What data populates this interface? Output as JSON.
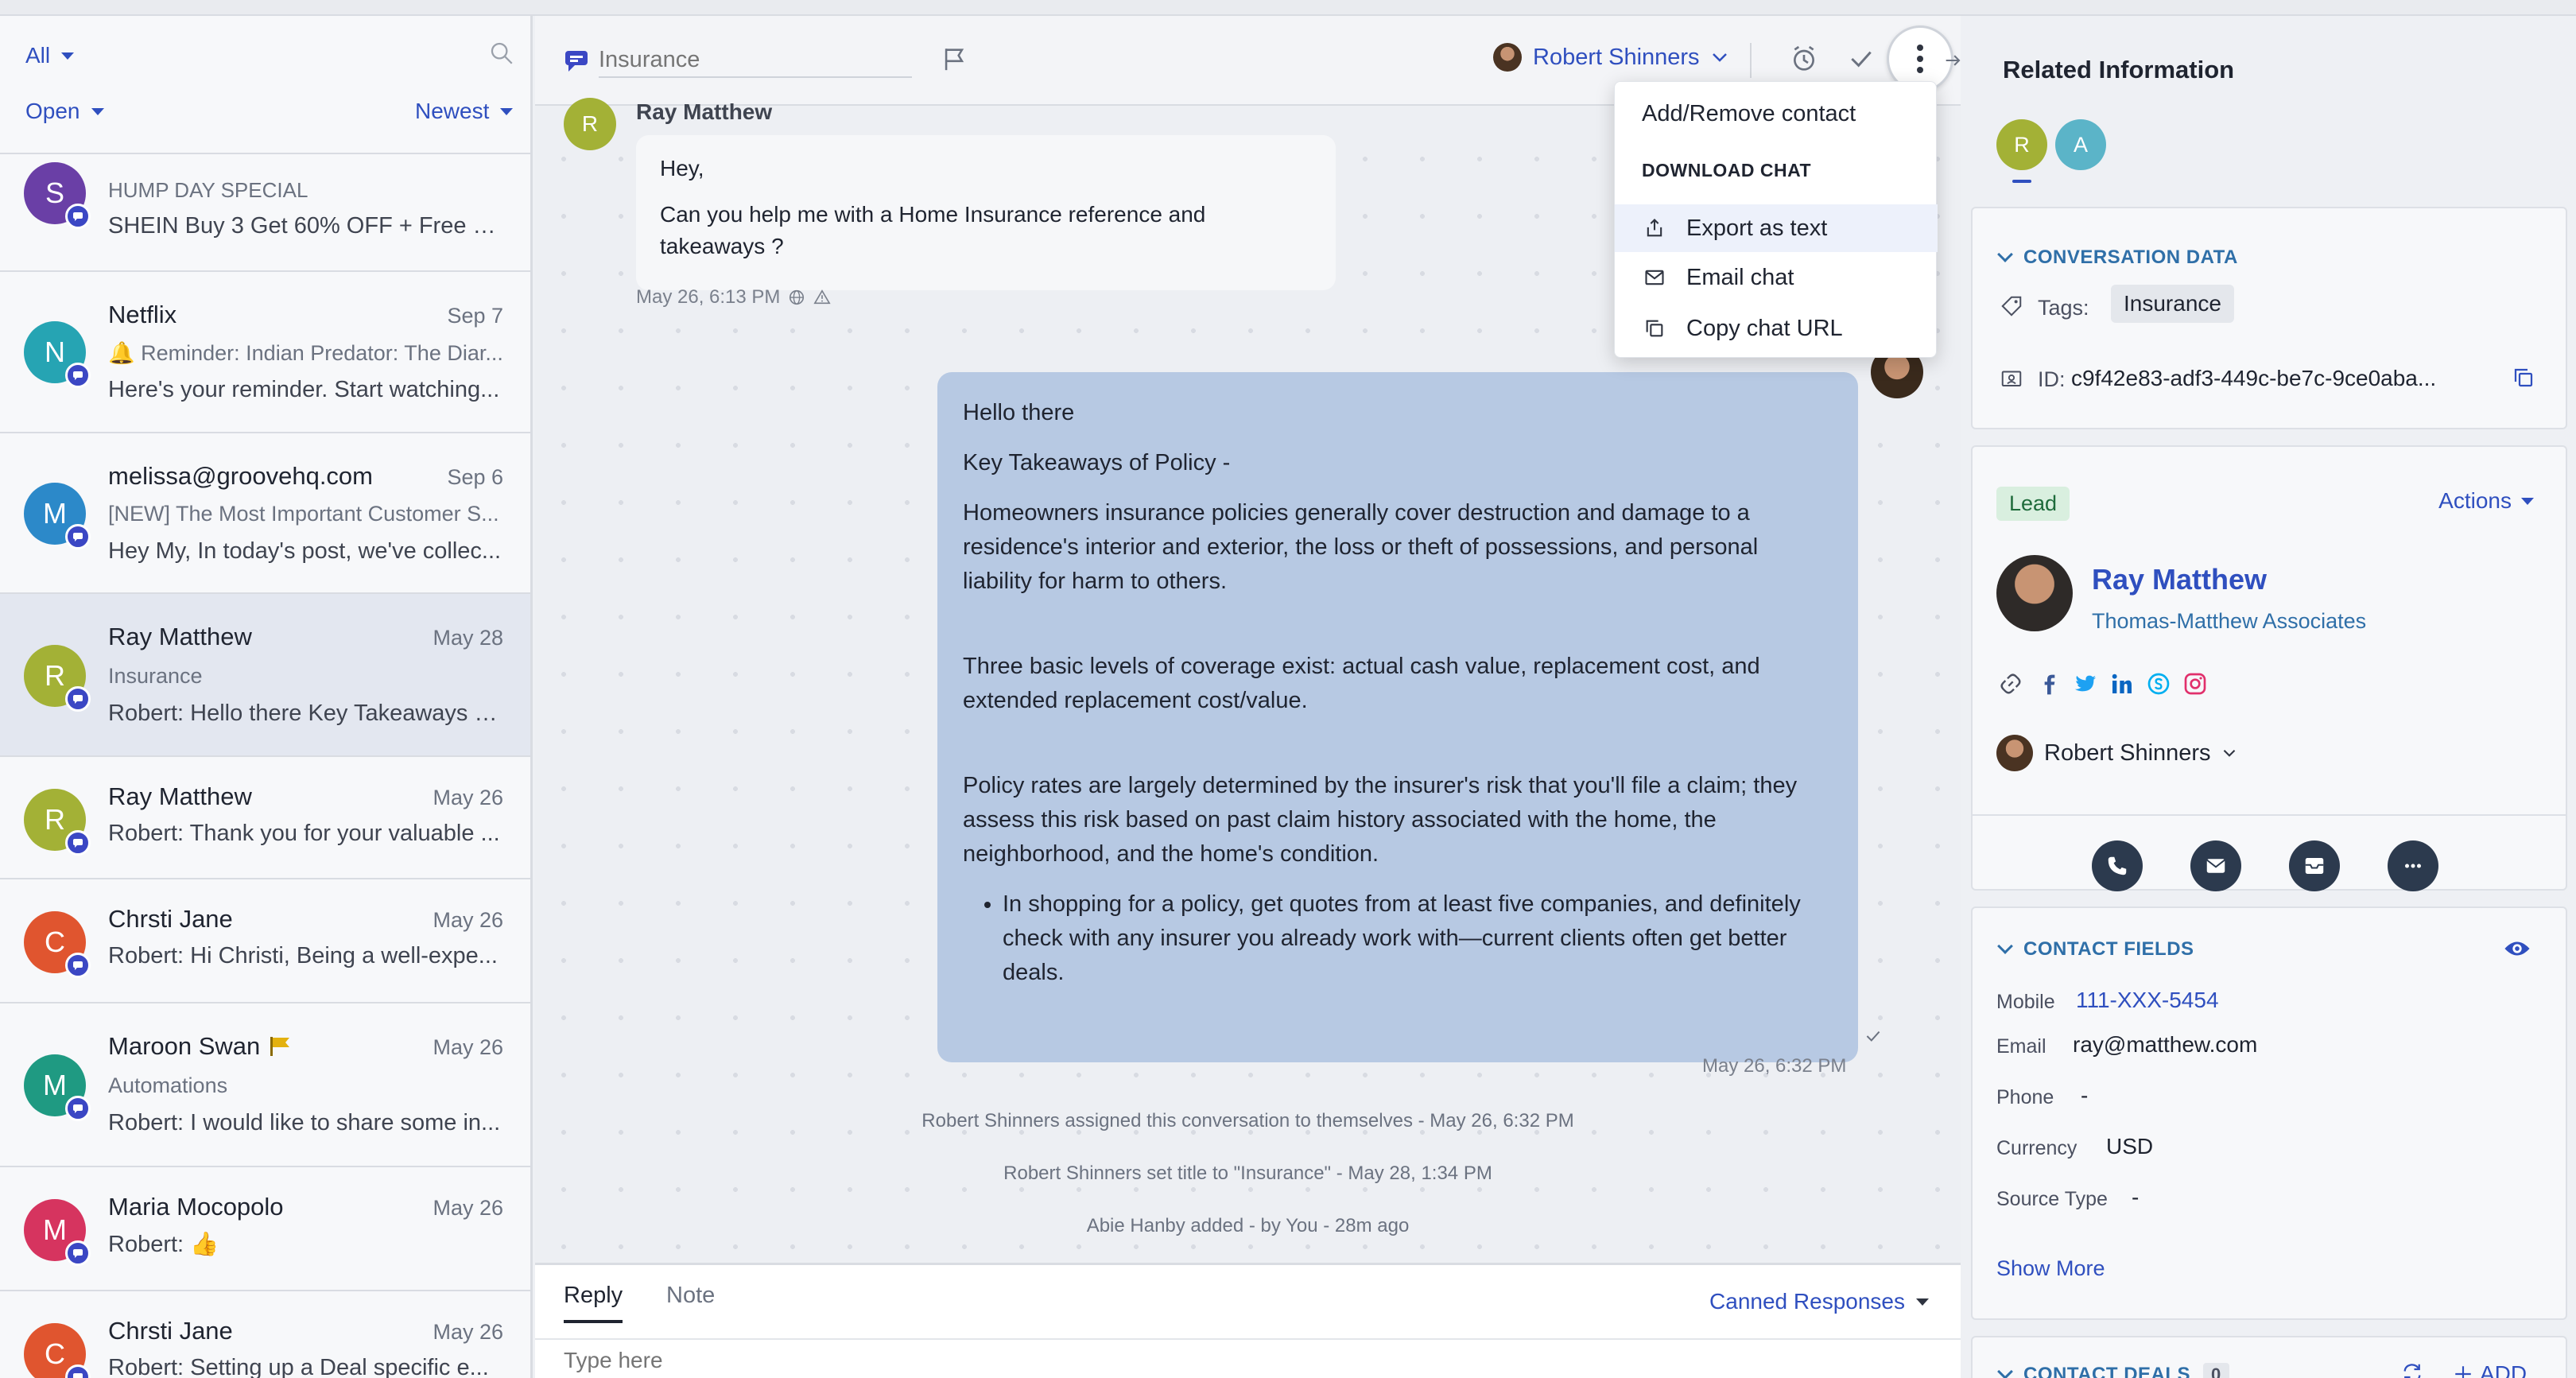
{
  "list": {
    "filter_all": "All",
    "filter_status": "Open",
    "filter_sort": "Newest",
    "conversations": [
      {
        "initial": "S",
        "avatar_color": "#6a3fa6",
        "name": "",
        "date": "",
        "line1": "HUMP DAY SPECIAL",
        "line2": "SHEIN Buy 3 Get 60% OFF + Free S..."
      },
      {
        "initial": "N",
        "avatar_color": "#26a4b3",
        "name": "Netflix",
        "date": "Sep 7",
        "line1": "🔔 Reminder: Indian Predator: The Diar...",
        "line2": "Here's your reminder. Start watching..."
      },
      {
        "initial": "M",
        "avatar_color": "#2c89c9",
        "name": "melissa@groovehq.com",
        "date": "Sep 6",
        "line1": "[NEW] The Most Important Customer S...",
        "line2": "Hey My, In today's post, we've collec..."
      },
      {
        "initial": "R",
        "avatar_color": "#a3b136",
        "name": "Ray Matthew",
        "date": "May 28",
        "line1": "Insurance",
        "line2": "Robert: Hello there Key Takeaways o..."
      },
      {
        "initial": "R",
        "avatar_color": "#a3b136",
        "name": "Ray Matthew",
        "date": "May 26",
        "line1": "",
        "line2": "Robert: Thank you for your valuable ..."
      },
      {
        "initial": "C",
        "avatar_color": "#e0552f",
        "name": "Chrsti Jane",
        "date": "May 26",
        "line1": "",
        "line2": "Robert: Hi Christi, Being a well-expe..."
      },
      {
        "initial": "M",
        "avatar_color": "#1f9a82",
        "name": "Maroon Swan",
        "date": "May 26",
        "line1": "Automations",
        "line2": "Robert: I would like to share some in..."
      },
      {
        "initial": "M",
        "avatar_color": "#d6345f",
        "name": "Maria Mocopolo",
        "date": "May 26",
        "line1": "",
        "line2": "Robert: 👍"
      },
      {
        "initial": "C",
        "avatar_color": "#e0552f",
        "name": "Chrsti Jane",
        "date": "May 26",
        "line1": "",
        "line2": "Robert: Setting up a Deal specific e..."
      }
    ]
  },
  "chat": {
    "title_placeholder": "Insurance",
    "assignee": "Robert Shinners",
    "incoming": {
      "author": "Ray Matthew",
      "author_initial": "R",
      "line1": "Hey,",
      "line2": "Can you help me with a Home Insurance reference and takeaways ?",
      "time": "May 26, 6:13 PM"
    },
    "outgoing": {
      "p1": "Hello there",
      "p2": "Key Takeaways of Policy -",
      "p3": "Homeowners insurance policies generally cover destruction and damage to a residence's interior and exterior, the loss or theft of possessions, and personal liability for harm to others.",
      "p4": "Three basic levels of coverage exist: actual cash value, replacement cost, and extended replacement cost/value.",
      "p5": "Policy rates are largely determined by the insurer's risk that you'll file a claim; they assess this risk based on past claim history associated with the home, the neighborhood, and the home's condition.",
      "bullet": "In shopping for a policy, get quotes from at least five companies, and definitely check with any insurer you already work with—current clients often get better deals.",
      "time": "May 26, 6:32 PM"
    },
    "events": [
      "Robert Shinners assigned this conversation to themselves - May 26, 6:32 PM",
      "Robert Shinners set title to \"Insurance\" - May 28, 1:34 PM",
      "Abie Hanby added - by You - 28m ago"
    ],
    "composer": {
      "tab_reply": "Reply",
      "tab_note": "Note",
      "canned": "Canned Responses",
      "placeholder": "Type here"
    }
  },
  "menu": {
    "add_remove": "Add/Remove contact",
    "section": "DOWNLOAD CHAT",
    "export": "Export as text",
    "email": "Email chat",
    "copy": "Copy chat URL"
  },
  "right": {
    "title": "Related Information",
    "participants": [
      {
        "initial": "R",
        "color": "#a3b136"
      },
      {
        "initial": "A",
        "color": "#5bb4c8"
      }
    ],
    "conv_data": {
      "heading": "CONVERSATION DATA",
      "tags_label": "Tags:",
      "tag": "Insurance",
      "id_label": "ID:",
      "id_value": "c9f42e83-adf3-449c-be7c-9ce0aba..."
    },
    "contact": {
      "badge": "Lead",
      "actions": "Actions",
      "name": "Ray Matthew",
      "company": "Thomas-Matthew Associates",
      "owner": "Robert Shinners"
    },
    "fields": {
      "heading": "CONTACT FIELDS",
      "mobile_label": "Mobile",
      "mobile": "111-XXX-5454",
      "email_label": "Email",
      "email": "ray@matthew.com",
      "phone_label": "Phone",
      "phone": "-",
      "currency_label": "Currency",
      "currency": "USD",
      "source_label": "Source Type",
      "source": "-",
      "show_more": "Show More"
    },
    "deals": {
      "heading": "CONTACT DEALS",
      "count": "0",
      "add": "ADD"
    }
  },
  "colors": {
    "accent": "#2f4fbf",
    "outgoing_bubble": "#b7c9e3",
    "lead": "#1e6b3b"
  }
}
